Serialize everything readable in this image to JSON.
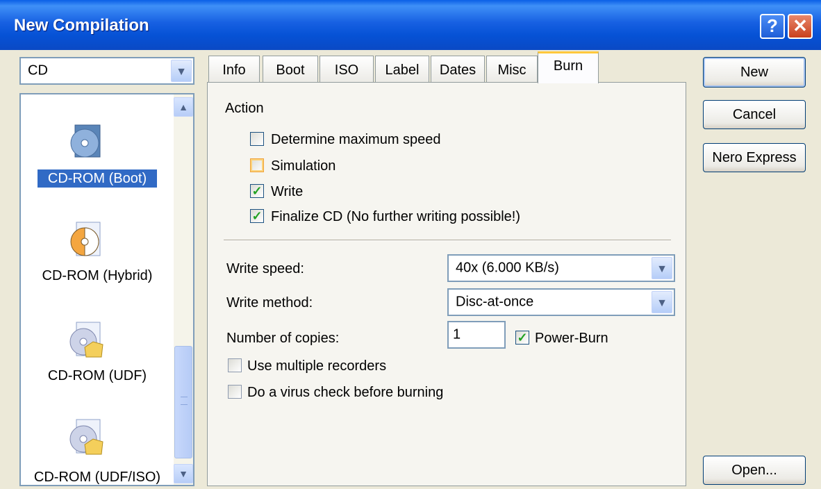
{
  "window": {
    "title": "New Compilation",
    "help": "?",
    "close": "✕"
  },
  "media_combo": {
    "value": "CD",
    "arrow": "▼"
  },
  "compilation_types": [
    {
      "label": "CD-ROM (Boot)",
      "icon": "cd-boot-icon",
      "selected": true
    },
    {
      "label": "CD-ROM (Hybrid)",
      "icon": "cd-hybrid-icon",
      "selected": false
    },
    {
      "label": "CD-ROM (UDF)",
      "icon": "cd-udf-icon",
      "selected": false
    },
    {
      "label": "CD-ROM (UDF/ISO)",
      "icon": "cd-udf-iso-icon",
      "selected": false
    }
  ],
  "scroll": {
    "up": "▲",
    "down": "▼"
  },
  "tabs": [
    "Info",
    "Boot",
    "ISO",
    "Label",
    "Dates",
    "Misc",
    "Burn"
  ],
  "active_tab": "Burn",
  "burn": {
    "action_label": "Action",
    "options": [
      {
        "label": "Determine maximum speed",
        "checked": false,
        "mark": ""
      },
      {
        "label": "Simulation",
        "checked": false,
        "mark": ""
      },
      {
        "label": "Write",
        "checked": true,
        "mark": "✓"
      },
      {
        "label": "Finalize CD (No further writing possible!)",
        "checked": true,
        "mark": "✓"
      }
    ],
    "write_speed": {
      "label": "Write speed:",
      "value": "40x (6.000 KB/s)"
    },
    "write_method": {
      "label": "Write method:",
      "value": "Disc-at-once"
    },
    "copies": {
      "label": "Number of copies:",
      "value": "1"
    },
    "power_burn": {
      "label": "Power-Burn",
      "checked": true,
      "mark": "✓"
    },
    "multiple_recorders": {
      "label": "Use multiple recorders",
      "checked": false,
      "mark": ""
    },
    "virus_check": {
      "label": "Do a virus check before burning",
      "checked": false,
      "mark": ""
    }
  },
  "buttons": {
    "new": "New",
    "cancel": "Cancel",
    "nero_express": "Nero Express",
    "open": "Open..."
  },
  "colors": {
    "title_bar": "#0a5fe6",
    "selection": "#316ac5",
    "active_tab_accent": "#ffc83c",
    "dialog_bg": "#ece9d8"
  }
}
